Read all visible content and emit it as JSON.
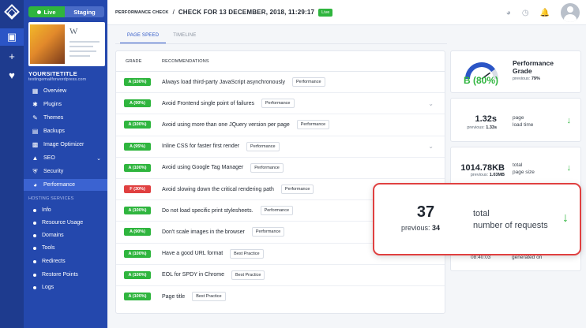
{
  "sidebar": {
    "env": {
      "live": "Live",
      "staging": "Staging"
    },
    "site_title": "YOURSITETITLE",
    "site_url": "testingemailforwordpress.com",
    "nav": [
      {
        "label": "Overview",
        "icon": "grid-icon"
      },
      {
        "label": "Plugins",
        "icon": "plugin-icon"
      },
      {
        "label": "Themes",
        "icon": "brush-icon"
      },
      {
        "label": "Backups",
        "icon": "database-icon"
      },
      {
        "label": "Image Optimizer",
        "icon": "image-icon"
      },
      {
        "label": "SEO",
        "icon": "chart-icon"
      },
      {
        "label": "Security",
        "icon": "shield-icon"
      },
      {
        "label": "Performance",
        "icon": "speedometer-icon"
      }
    ],
    "hosting_header": "HOSTING SERVICES",
    "hosting": [
      "Info",
      "Resource Usage",
      "Domains",
      "Tools",
      "Redirects",
      "Restore Points",
      "Logs"
    ]
  },
  "header": {
    "small": "PERFORMANCE CHECK",
    "separator": "/",
    "title": "CHECK FOR 13 DECEMBER, 2018, 11:29:17",
    "badge": "Live"
  },
  "tabs": [
    "PAGE SPEED",
    "TIMELINE"
  ],
  "table": {
    "headers": [
      "GRADE",
      "RECOMMENDATIONS"
    ],
    "rows": [
      {
        "grade": "A (100%)",
        "color": "#2fb53e",
        "text": "Always load third-party JavaScript asynchronously",
        "tag": "Performance",
        "expand": false
      },
      {
        "grade": "A (90%)",
        "color": "#2fb53e",
        "text": "Avoid Frontend single point of failures",
        "tag": "Performance",
        "expand": true
      },
      {
        "grade": "A (100%)",
        "color": "#2fb53e",
        "text": "Avoid using more than one JQuery version per page",
        "tag": "Performance",
        "expand": false
      },
      {
        "grade": "A (95%)",
        "color": "#2fb53e",
        "text": "Inline CSS for faster first render",
        "tag": "Performance",
        "expand": true
      },
      {
        "grade": "A (100%)",
        "color": "#2fb53e",
        "text": "Avoid using Google Tag Manager",
        "tag": "Performance",
        "expand": false
      },
      {
        "grade": "F (30%)",
        "color": "#e04040",
        "text": "Avoid slowing down the critical rendering path",
        "tag": "Performance",
        "expand": false
      },
      {
        "grade": "A (100%)",
        "color": "#2fb53e",
        "text": "Do not load specific print stylesheets.",
        "tag": "Performance",
        "expand": false
      },
      {
        "grade": "A (90%)",
        "color": "#2fb53e",
        "text": "Don't scale images in the browser",
        "tag": "Performance",
        "expand": false
      },
      {
        "grade": "A (100%)",
        "color": "#2fb53e",
        "text": "Have a good URL format",
        "tag": "Best Practice",
        "expand": false
      },
      {
        "grade": "A (100%)",
        "color": "#2fb53e",
        "text": "EOL for SPDY in Chrome",
        "tag": "Best Practice",
        "expand": false
      },
      {
        "grade": "A (100%)",
        "color": "#2fb53e",
        "text": "Page title",
        "tag": "Best Practice",
        "expand": false
      }
    ]
  },
  "performance": {
    "grade": "B (80%)",
    "title_line1": "Performance",
    "title_line2": "Grade",
    "prev_label": "previous:",
    "prev_value": "79%",
    "gauge_fraction": 0.8
  },
  "metrics": {
    "load_time": {
      "value": "1.32s",
      "prev_label": "previous:",
      "prev_value": "1.33s",
      "label_line1": "page",
      "label_line2": "load time"
    },
    "page_size": {
      "value": "1014.78KB",
      "prev_label": "previous:",
      "prev_value": "1.03MB",
      "label_line1": "total",
      "label_line2": "page size"
    },
    "requests": {
      "value": "37",
      "prev_label": "previous:",
      "prev_value": "34",
      "label_line1": "total",
      "label_line2": "number of requests"
    },
    "generated": {
      "value": "08:40:03",
      "label": "generated on"
    }
  }
}
